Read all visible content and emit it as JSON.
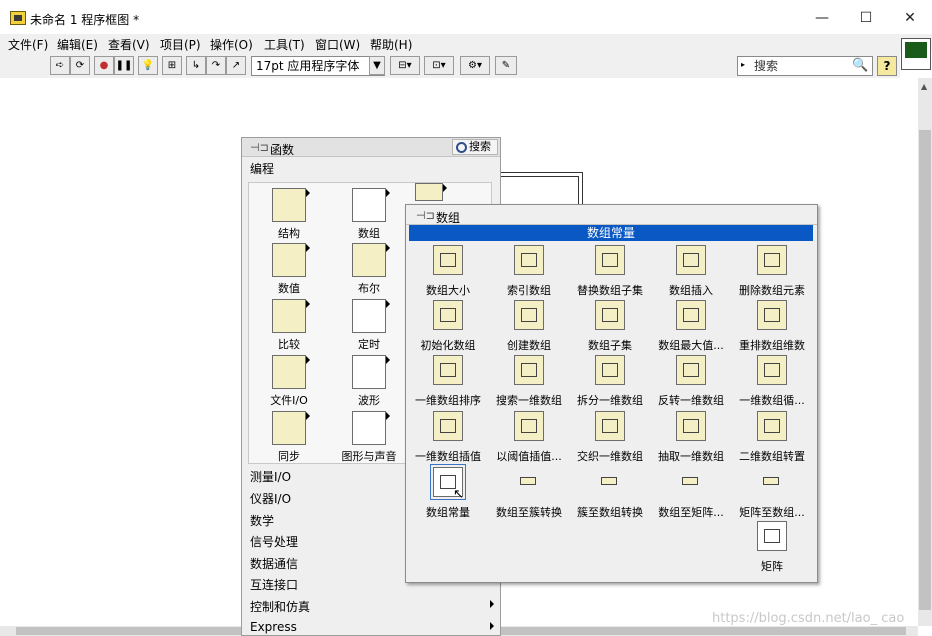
{
  "window": {
    "title": "未命名 1 程序框图 *",
    "controls": [
      "—",
      "☐",
      "✕"
    ]
  },
  "menubar": [
    "文件(F)",
    "编辑(E)",
    "查看(V)",
    "项目(P)",
    "操作(O)",
    "工具(T)",
    "窗口(W)",
    "帮助(H)"
  ],
  "toolbar": {
    "font": "17pt 应用程序字体",
    "search_placeholder": "搜索",
    "help": "?"
  },
  "functions_palette": {
    "title": "函数",
    "search": "搜索",
    "section": "编程",
    "items": [
      "结构",
      "数组",
      "数值",
      "布尔",
      "比较",
      "定时",
      "文件I/O",
      "波形",
      "同步",
      "图形与声音"
    ],
    "categories": [
      "测量I/O",
      "仪器I/O",
      "数学",
      "信号处理",
      "数据通信",
      "互连接口",
      "控制和仿真",
      "Express"
    ]
  },
  "array_palette": {
    "title": "数组",
    "highlight": "数组常量",
    "items": [
      "数组大小",
      "索引数组",
      "替换数组子集",
      "数组插入",
      "删除数组元素",
      "初始化数组",
      "创建数组",
      "数组子集",
      "数组最大值...",
      "重排数组维数",
      "一维数组排序",
      "搜索一维数组",
      "拆分一维数组",
      "反转一维数组",
      "一维数组循...",
      "一维数组插值",
      "以阈值插值...",
      "交织一维数组",
      "抽取一维数组",
      "二维数组转置",
      "数组常量",
      "数组至簇转换",
      "簇至数组转换",
      "数组至矩阵...",
      "矩阵至数组...",
      "矩阵"
    ]
  },
  "watermark": "https://blog.csdn.net/lao_    cao"
}
